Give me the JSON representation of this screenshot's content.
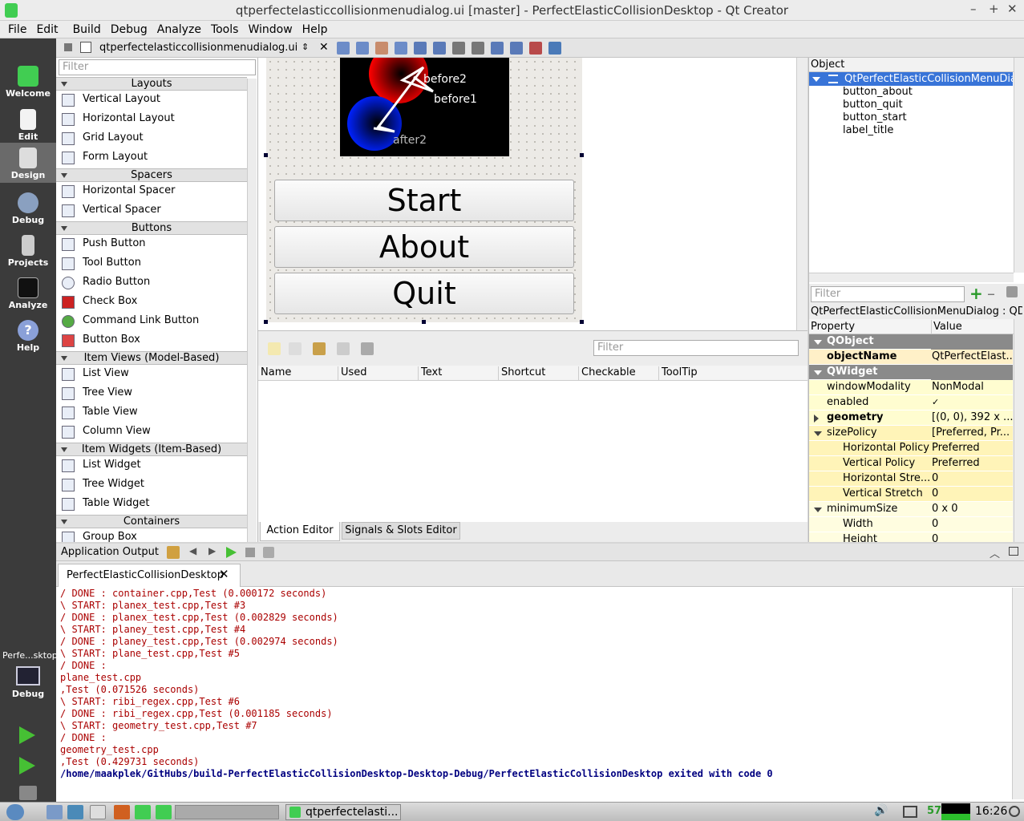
{
  "window": {
    "title": "qtperfectelasticcollisionmenudialog.ui [master] - PerfectElasticCollisionDesktop - Qt Creator"
  },
  "menu": [
    "File",
    "Edit",
    "Build",
    "Debug",
    "Analyze",
    "Tools",
    "Window",
    "Help"
  ],
  "modes": [
    {
      "label": "Welcome"
    },
    {
      "label": "Edit"
    },
    {
      "label": "Design"
    },
    {
      "label": "Debug"
    },
    {
      "label": "Projects"
    },
    {
      "label": "Analyze"
    },
    {
      "label": "Help"
    }
  ],
  "editor_toolbar": {
    "file": "qtperfectelasticcollisionmenudialog.ui"
  },
  "widgetbox": {
    "filter_placeholder": "Filter",
    "sections": [
      {
        "title": "Layouts",
        "items": [
          "Vertical Layout",
          "Horizontal Layout",
          "Grid Layout",
          "Form Layout"
        ]
      },
      {
        "title": "Spacers",
        "items": [
          "Horizontal Spacer",
          "Vertical Spacer"
        ]
      },
      {
        "title": "Buttons",
        "items": [
          "Push Button",
          "Tool Button",
          "Radio Button",
          "Check Box",
          "Command Link Button",
          "Button Box"
        ]
      },
      {
        "title": "Item Views (Model-Based)",
        "items": [
          "List View",
          "Tree View",
          "Table View",
          "Column View"
        ]
      },
      {
        "title": "Item Widgets (Item-Based)",
        "items": [
          "List Widget",
          "Tree Widget",
          "Table Widget"
        ]
      },
      {
        "title": "Containers",
        "items": [
          "Group Box"
        ]
      }
    ]
  },
  "form": {
    "image_labels": [
      "before2",
      "before1",
      "after2"
    ],
    "buttons": [
      "Start",
      "About",
      "Quit"
    ]
  },
  "action_editor": {
    "filter_placeholder": "Filter",
    "columns": [
      "Name",
      "Used",
      "Text",
      "Shortcut",
      "Checkable",
      "ToolTip"
    ],
    "tabs": [
      "Action Editor",
      "Signals & Slots Editor"
    ]
  },
  "object_inspector": {
    "header": "Object",
    "root": "QtPerfectElasticCollisionMenuDialog",
    "children": [
      "button_about",
      "button_quit",
      "button_start",
      "label_title"
    ]
  },
  "property_editor": {
    "filter_placeholder": "Filter",
    "class_line": "QtPerfectElasticCollisionMenuDialog : QDi...",
    "col_property": "Property",
    "col_value": "Value",
    "rows": [
      {
        "k": "QObject",
        "v": "",
        "kind": "group"
      },
      {
        "k": "objectName",
        "v": "QtPerfectElast...",
        "kind": "bold"
      },
      {
        "k": "QWidget",
        "v": "",
        "kind": "group"
      },
      {
        "k": "windowModality",
        "v": "NonModal",
        "kind": "normal"
      },
      {
        "k": "enabled",
        "v": "✓",
        "kind": "normal"
      },
      {
        "k": "geometry",
        "v": "[(0, 0), 392 x ...",
        "kind": "boldarrow"
      },
      {
        "k": "sizePolicy",
        "v": "[Preferred, Pr...",
        "kind": "expanded"
      },
      {
        "k": "Horizontal Policy",
        "v": "Preferred",
        "kind": "child"
      },
      {
        "k": "Vertical Policy",
        "v": "Preferred",
        "kind": "child"
      },
      {
        "k": "Horizontal Stre...",
        "v": "0",
        "kind": "child"
      },
      {
        "k": "Vertical Stretch",
        "v": "0",
        "kind": "child"
      },
      {
        "k": "minimumSize",
        "v": "0 x 0",
        "kind": "expanded2"
      },
      {
        "k": "Width",
        "v": "0",
        "kind": "child2"
      },
      {
        "k": "Height",
        "v": "0",
        "kind": "child2"
      }
    ]
  },
  "output": {
    "title": "Application Output",
    "tab": "PerfectElasticCollisionDesktop",
    "lines": [
      "/ DONE : container.cpp,Test (0.000172 seconds)",
      "\\ START: planex_test.cpp,Test #3",
      "/ DONE : planex_test.cpp,Test (0.002829 seconds)",
      "\\ START: planey_test.cpp,Test #4",
      "/ DONE : planey_test.cpp,Test (0.002974 seconds)",
      "\\ START: plane_test.cpp,Test #5",
      "/ DONE :",
      "plane_test.cpp",
      ",Test (0.071526 seconds)",
      "\\ START: ribi_regex.cpp,Test #6",
      "/ DONE : ribi_regex.cpp,Test (0.001185 seconds)",
      "\\ START: geometry_test.cpp,Test #7",
      "/ DONE :",
      "geometry_test.cpp",
      ",Test (0.429731 seconds)"
    ],
    "final": "/home/maakplek/GitHubs/build-PerfectElasticCollisionDesktop-Desktop-Debug/PerfectElasticCollisionDesktop exited with code 0"
  },
  "kit": {
    "name": "Perfe...sktop",
    "mode": "Debug"
  },
  "taskbar": {
    "task": "qtperfectelasti...",
    "number": "57",
    "clock": "16:26"
  }
}
